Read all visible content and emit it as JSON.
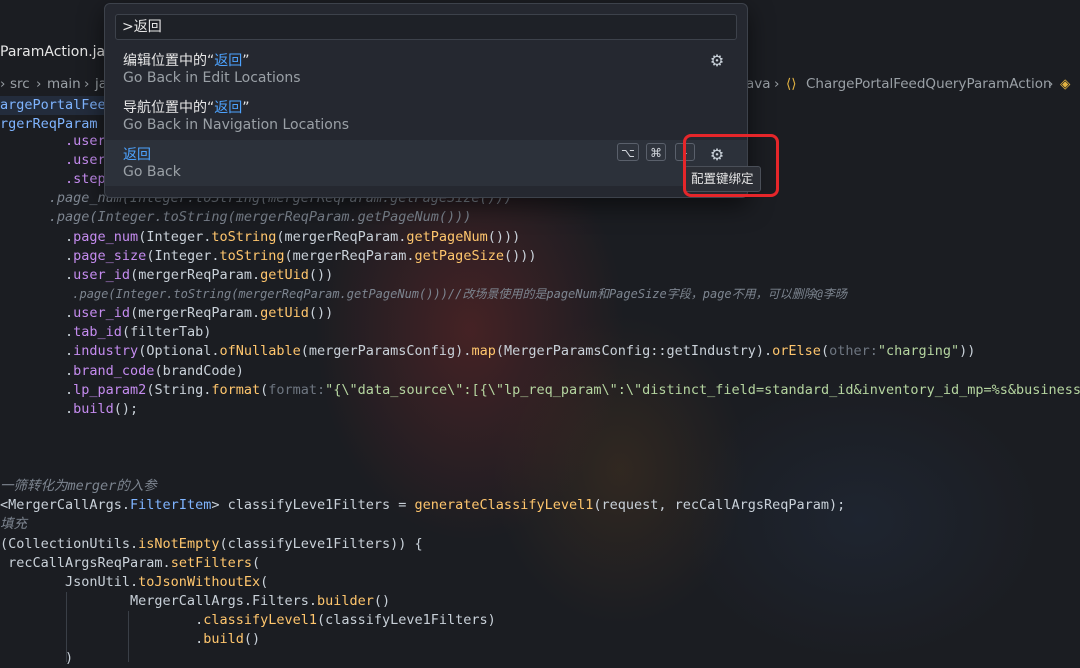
{
  "editor": {
    "tab_title": "ParamAction.java",
    "breadcrumb": {
      "src": "src",
      "main": "main",
      "ja": "ja",
      "java": "ava",
      "class": "ChargePortalFeedQueryParamAction"
    }
  },
  "palette": {
    "input_value": ">返回",
    "items": [
      {
        "title_prefix": "编辑位置中的“",
        "title_q": "返回",
        "title_suffix": "”",
        "subtitle": "Go Back in Edit Locations",
        "icon": "gear-icon"
      },
      {
        "title_prefix": "导航位置中的“",
        "title_q": "返回",
        "title_suffix": "”",
        "subtitle": "Go Back in Navigation Locations"
      },
      {
        "title": "返回",
        "subtitle": "Go Back",
        "keys": [
          "⌥",
          "⌘",
          "-"
        ],
        "icon": "gear-icon"
      }
    ],
    "tooltip": "配置键绑定"
  },
  "code": {
    "l1": "argePortalFeedQ",
    "l2a": "rgerReqParam ",
    "l2b": "bui",
    "l3": "        .user_",
    "l4": "        .user_",
    "l5": "        .step",
    "l6": "      .page_num(Integer.toString(mergerReqParam.getPageSize()))",
    "l7": "      .page(Integer.toString(mergerReqParam.getPageNum()))",
    "l8a": "        .",
    "l8b": "page_num",
    "l8c": "(Integer.",
    "l8d": "toString",
    "l8e": "(mergerReqParam.",
    "l8f": "getPageNum",
    "l8g": "()))",
    "l9a": "        .",
    "l9b": "page_size",
    "l9c": "(Integer.",
    "l9d": "toString",
    "l9e": "(mergerReqParam.",
    "l9f": "getPageSize",
    "l9g": "()))",
    "l10a": "        .",
    "l10b": "user_id",
    "l10c": "(mergerReqParam.",
    "l10d": "getUid",
    "l10e": "())",
    "l11": "          .page(Integer.toString(mergerReqParam.getPageNum()))//改场景使用的是pageNum和PageSize字段，page不用，可以删除@李旸",
    "l12a": "        .",
    "l12b": "user_id",
    "l12c": "(mergerReqParam.",
    "l12d": "getUid",
    "l12e": "())",
    "l13a": "        .",
    "l13b": "tab_id",
    "l13c": "(filterTab)",
    "l14a": "        .",
    "l14b": "industry",
    "l14c": "(Optional.",
    "l14d": "ofNullable",
    "l14e": "(mergerParamsConfig).",
    "l14f": "map",
    "l14g": "(MergerParamsConfig::getIndustry).",
    "l14h": "orElse",
    "l14i": "(",
    "l14j": "other:",
    "l14k": "\"charging\"",
    "l14l": "))",
    "l15a": "        .",
    "l15b": "brand_code",
    "l15c": "(brandCode)",
    "l16a": "        .",
    "l16b": "lp_param2",
    "l16c": "(String.",
    "l16d": "format",
    "l16e": "(",
    "l16f": "format:",
    "l16g": "\"{\\\"data_source\\\":[{\\\"lp_req_param\\\":\\\"distinct_field=standard_id&inventory_id_mp=%s&business_type=%",
    "l17a": "        .",
    "l17b": "build",
    "l17c": "();",
    "l18": "一筛转化为merger的入参",
    "l19a": "<MergerCallArgs.",
    "l19b": "FilterItem",
    "l19c": "> classifyLeve1Filters = ",
    "l19d": "generateClassifyLevel1",
    "l19e": "(request, recCallArgsReqParam);",
    "l20": "填充",
    "l21a": "(CollectionUtils.",
    "l21b": "isNotEmpty",
    "l21c": "(classifyLeve1Filters)) {",
    "l22a": " recCallArgsReqParam.",
    "l22b": "setFilters",
    "l22c": "(",
    "l23a": "        JsonUtil.",
    "l23b": "toJsonWithoutEx",
    "l23c": "(",
    "l24a": "                MergerCallArgs.Filters.",
    "l24b": "builder",
    "l24c": "()",
    "l25a": "                        .",
    "l25b": "classifyLevel1",
    "l25c": "(classifyLeve1Filters)",
    "l26a": "                        .",
    "l26b": "build",
    "l26c": "()",
    "l27": "        )"
  }
}
